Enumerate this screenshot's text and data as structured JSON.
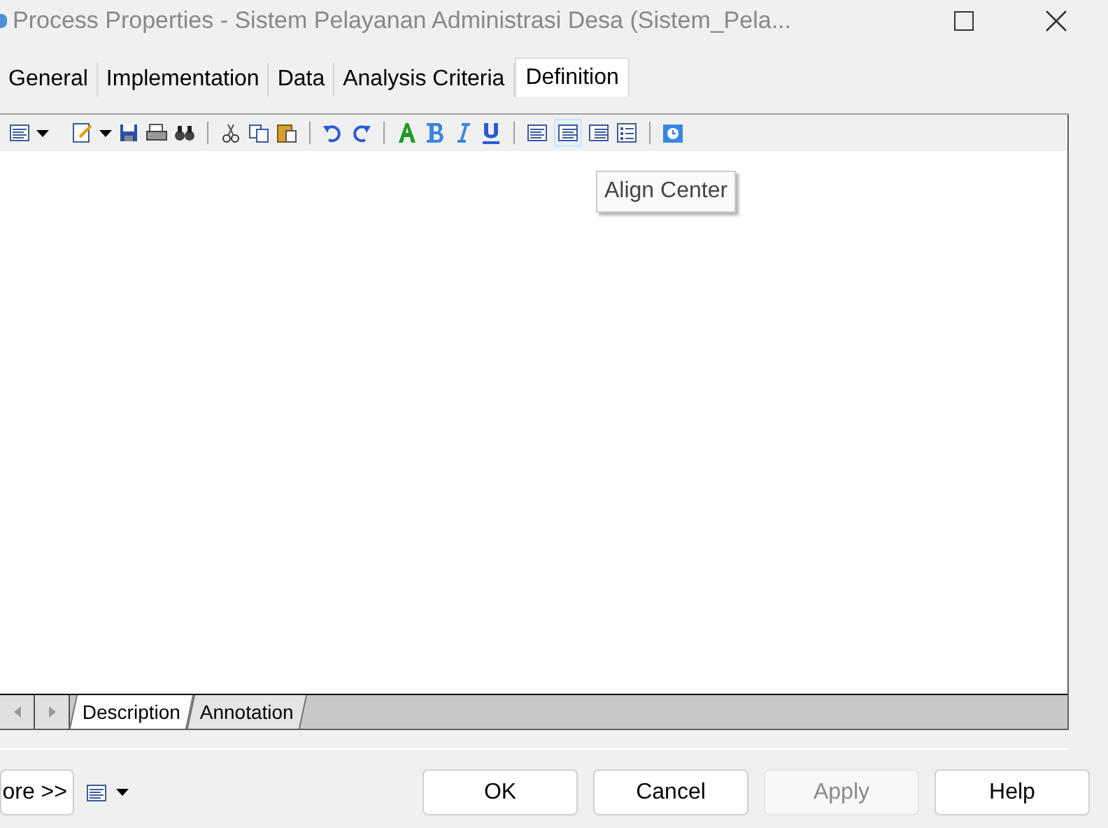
{
  "window": {
    "title": "Process Properties - Sistem Pelayanan Administrasi Desa (Sistem_Pela..."
  },
  "tabs": [
    {
      "label": "General",
      "selected": false
    },
    {
      "label": "Implementation",
      "selected": false
    },
    {
      "label": "Data",
      "selected": false
    },
    {
      "label": "Analysis Criteria",
      "selected": false
    },
    {
      "label": "Definition",
      "selected": true
    }
  ],
  "tooltip": {
    "text": "Align Center"
  },
  "sheet_tabs": [
    {
      "label": "Description",
      "selected": true
    },
    {
      "label": "Annotation",
      "selected": false
    }
  ],
  "more_button": {
    "label": "ore >>"
  },
  "buttons": [
    {
      "label": "OK",
      "disabled": false
    },
    {
      "label": "Cancel",
      "disabled": false
    },
    {
      "label": "Apply",
      "disabled": true
    },
    {
      "label": "Help",
      "disabled": false
    }
  ]
}
